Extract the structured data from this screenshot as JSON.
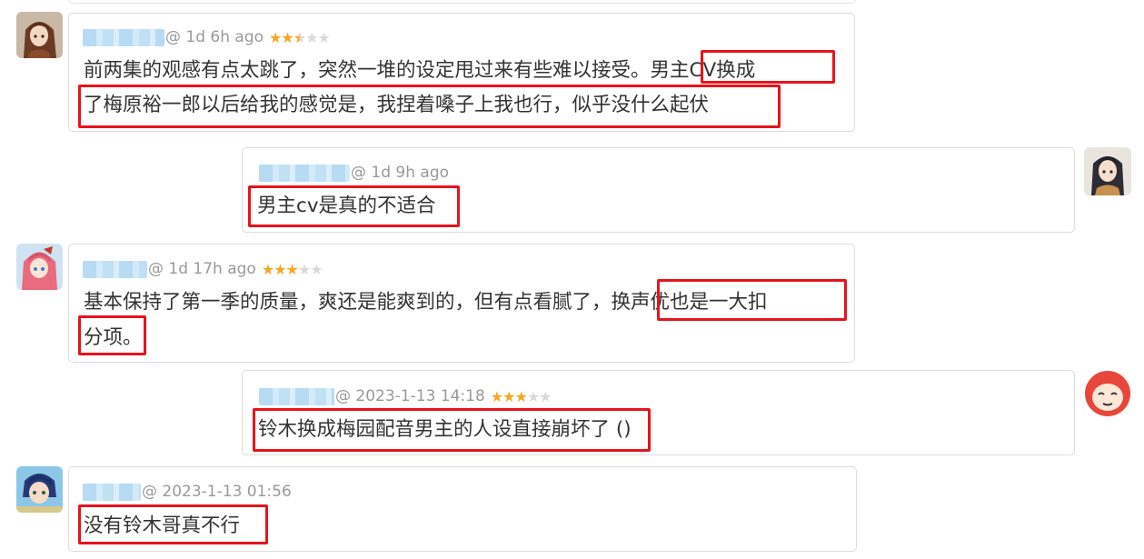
{
  "colors": {
    "star_on": "#f6a623",
    "star_off": "#d9d9d9",
    "highlight_box": "#e8131b",
    "meta_text": "#999999",
    "body_text": "#333333"
  },
  "comments": [
    {
      "meta": "@ 1d 6h ago",
      "rating": 2.5,
      "line1_plain": "前两集的观感有点太跳了，突然一堆的设定甩过来有些难以接受。",
      "line1_boxed": "男主CV换成",
      "line2_boxed": "了梅原裕一郎以后给我的感觉是，我捏着嗓子上我也行，似乎没什么起伏",
      "avatar_icon": "anime-girl-brown-hair-avatar-icon"
    },
    {
      "meta": "@ 1d 9h ago",
      "boxed": "男主cv是真的不适合",
      "avatar_icon": "anime-girl-dark-hair-avatar-icon"
    },
    {
      "meta": "@ 1d 17h ago",
      "rating": 3,
      "line1_plain": "基本保持了第一季的质量，爽还是能爽到的，但有点看腻了，",
      "line1_boxed": "换声优也是一大扣",
      "line2_boxed": "分项。",
      "avatar_icon": "anime-girl-pink-hair-avatar-icon"
    },
    {
      "meta": "@ 2023-1-13 14:18",
      "rating": 3,
      "boxed": "铃木换成梅园配音男主的人设直接崩坏了",
      "plain_after": " ()",
      "avatar_icon": "red-cartoon-face-avatar-icon"
    },
    {
      "meta": "@ 2023-1-13 01:56",
      "boxed": "没有铃木哥真不行",
      "avatar_icon": "anime-boy-blue-hair-avatar-icon"
    }
  ]
}
